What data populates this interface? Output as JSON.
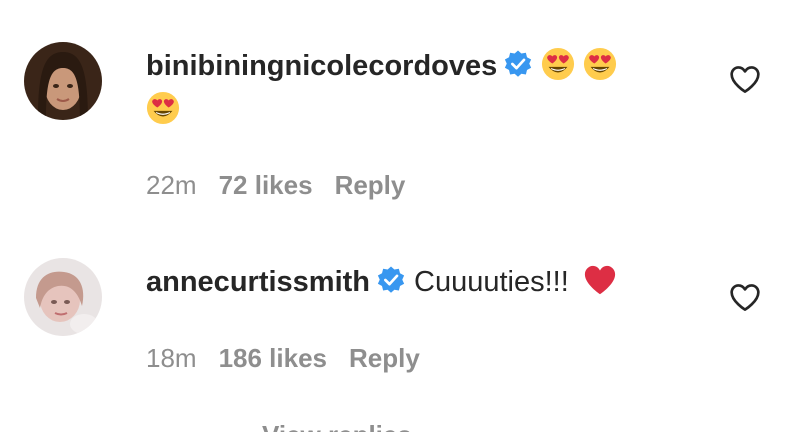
{
  "comments": [
    {
      "username": "binibiningnicolecordoves",
      "verified": true,
      "text": "",
      "emojis": [
        "heart-eyes-emoji",
        "heart-eyes-emoji",
        "heart-eyes-emoji"
      ],
      "time": "22m",
      "likes": "72 likes",
      "reply": "Reply"
    },
    {
      "username": "annecurtissmith",
      "verified": true,
      "text": "Cuuuuties!!!",
      "emojis": [
        "red-heart-emoji"
      ],
      "time": "18m",
      "likes": "186 likes",
      "reply": "Reply"
    }
  ],
  "partial_next_line": "View replies",
  "colors": {
    "text": "#262626",
    "meta": "#8e8e8e",
    "verified_blue": "#3897f0",
    "heart_red": "#ed4956",
    "emoji_yellow": "#ffcc4d"
  }
}
